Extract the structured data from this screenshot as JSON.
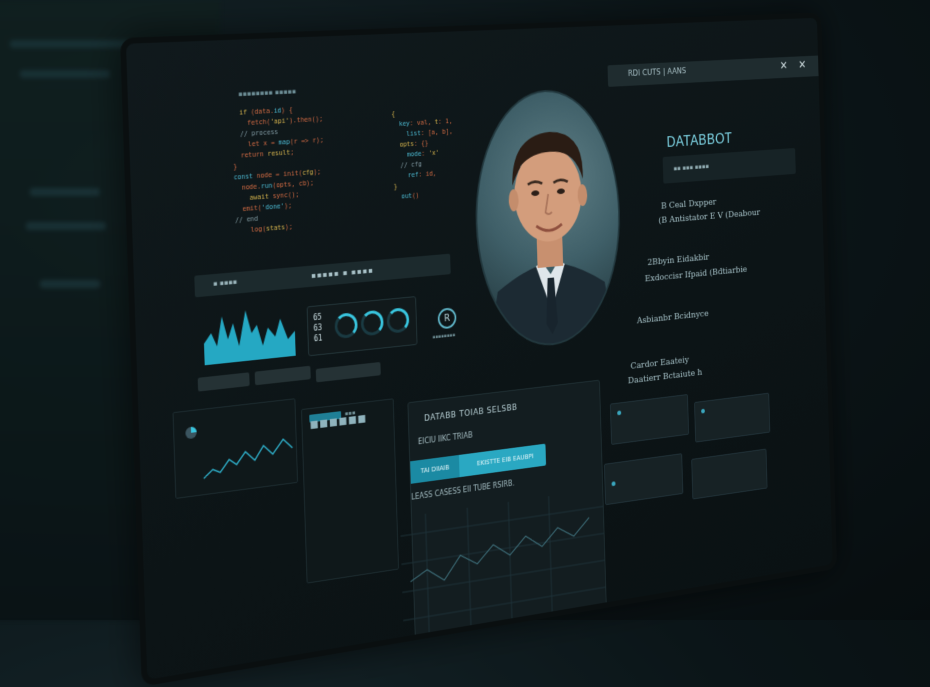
{
  "top_bar": {
    "title": "RDI CUTS | AANS",
    "close_1": "✕",
    "close_2": "✕"
  },
  "code_editor": {
    "file_label": "▪▪▪▪▪▪▪▪ ▪▪▪▪▪"
  },
  "dashboard_header": {
    "left": "▪ ▪▪▪▪",
    "right": "▪▪▪▪▪ ▪ ▪▪▪▪"
  },
  "gauges": {
    "readouts": [
      "65",
      "63",
      "61"
    ],
    "badge": "R",
    "badge_label": "▪▪▪▪▪▪▪▪"
  },
  "profile": {
    "name": "DATABBOT",
    "field": "▪▪ ▪▪▪ ▪▪▪▪",
    "line_1": "B Ceal Dxpper",
    "line_2": "(B Antistator E V (Deabour",
    "line_3": "2Bbyin Eidakbir",
    "line_4": "Exdoccisr Ifpaid (Bdtiarbie",
    "line_5": "Asbianbr Bcidnyce",
    "line_6": "Cardor Eaateiy",
    "line_7": "Daatierr Bctaiute h"
  },
  "lower_panel": {
    "title": "DATABB TOIAB SELSBB",
    "subtitle": "EICIU IIKC TRIAB",
    "tab_1": "TAI DIIAIB",
    "tab_2": "EKISTTE EIB EAUBPI",
    "cases": "LEASS CASESS EII TUBE RSIRB."
  },
  "left_panel": {
    "chip": "▪▪▪▪▪▪",
    "label": "▪▪▪"
  },
  "accent_color": "#39c5de",
  "icons": [
    "close-icon",
    "gauge-icon",
    "portrait-image",
    "line-chart-icon"
  ]
}
